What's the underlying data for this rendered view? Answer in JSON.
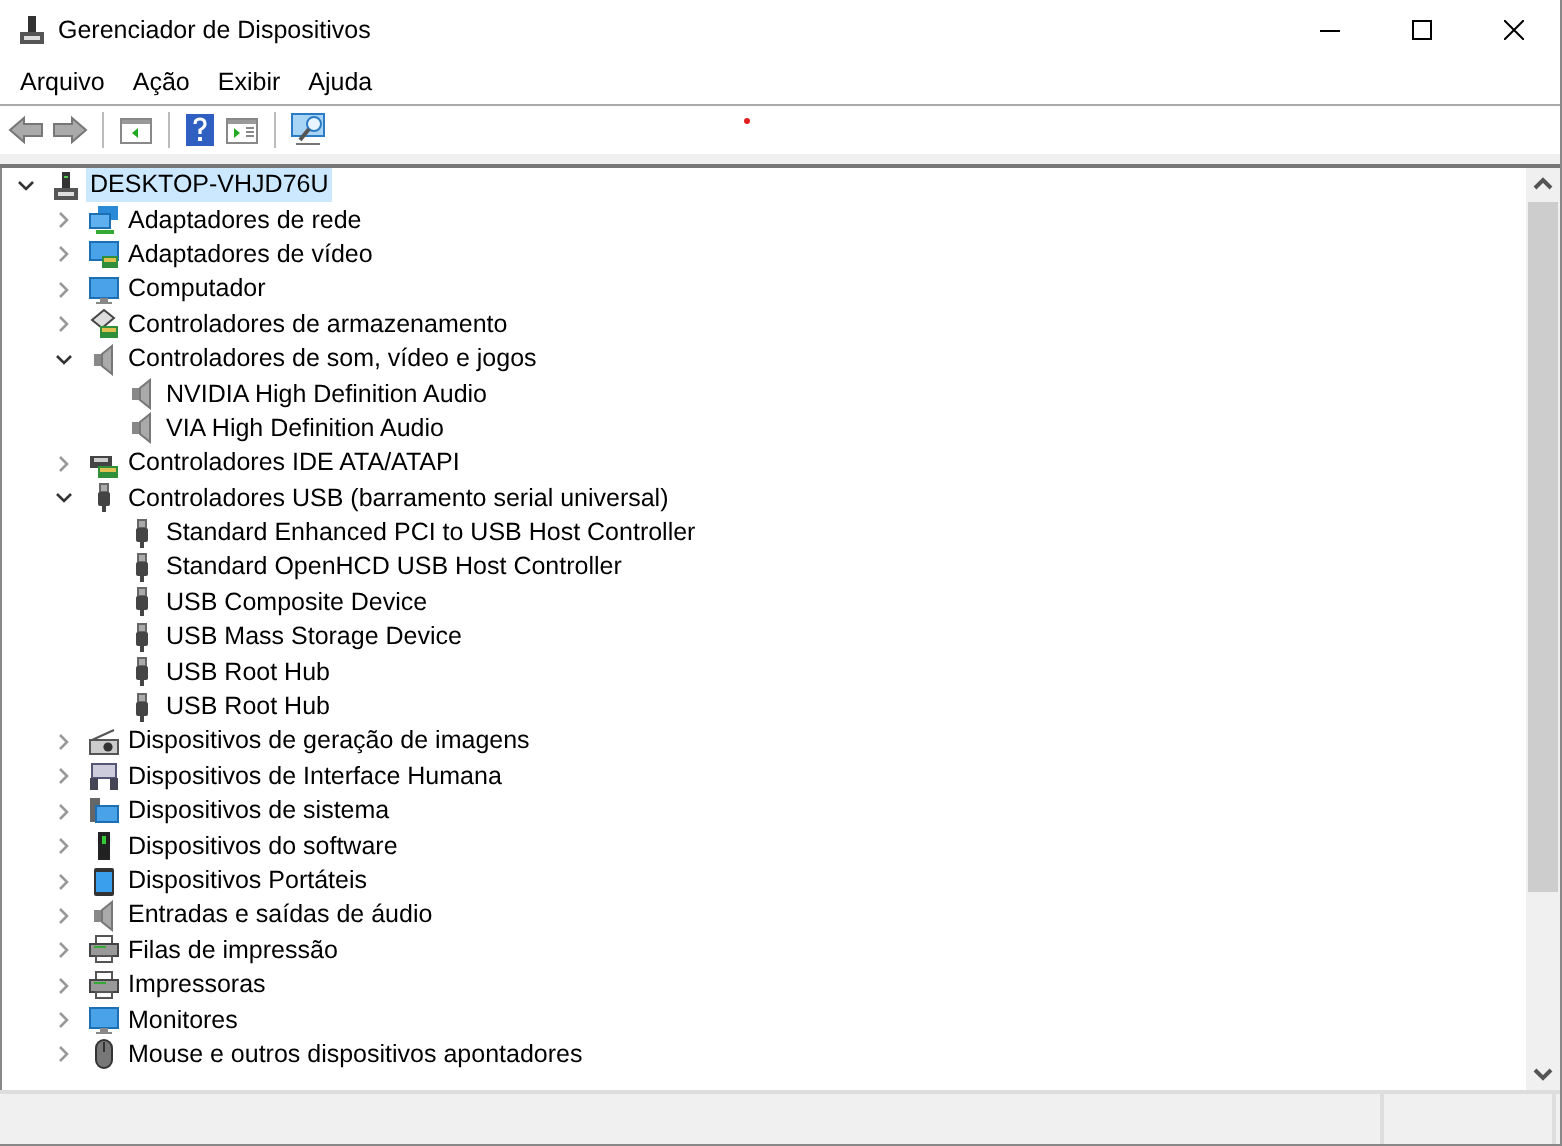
{
  "window": {
    "title": "Gerenciador de Dispositivos"
  },
  "menu": [
    "Arquivo",
    "Ação",
    "Exibir",
    "Ajuda"
  ],
  "toolbar": [
    {
      "kind": "back"
    },
    {
      "kind": "forward"
    },
    {
      "kind": "sep"
    },
    {
      "kind": "tree"
    },
    {
      "kind": "sep"
    },
    {
      "kind": "help"
    },
    {
      "kind": "pane"
    },
    {
      "kind": "sep"
    },
    {
      "kind": "scan"
    }
  ],
  "tree": [
    {
      "label": "DESKTOP-VHJD76U",
      "kind": "computer",
      "expanded": true,
      "selected": true,
      "children": [
        {
          "label": "Adaptadores de rede",
          "kind": "network",
          "expanded": false,
          "selected": false
        },
        {
          "label": "Adaptadores de vídeo",
          "kind": "display",
          "expanded": false,
          "selected": false
        },
        {
          "label": "Computador",
          "kind": "monitor",
          "expanded": false,
          "selected": false
        },
        {
          "label": "Controladores de armazenamento",
          "kind": "storage",
          "expanded": false,
          "selected": false
        },
        {
          "label": "Controladores de som, vídeo e jogos",
          "kind": "speaker",
          "expanded": true,
          "selected": false,
          "children": [
            {
              "label": "NVIDIA High Definition Audio",
              "kind": "speaker",
              "selected": false
            },
            {
              "label": "VIA High Definition Audio",
              "kind": "speaker",
              "selected": false
            }
          ]
        },
        {
          "label": "Controladores IDE ATA/ATAPI",
          "kind": "ide",
          "expanded": false,
          "selected": false
        },
        {
          "label": "Controladores USB (barramento serial universal)",
          "kind": "usb",
          "expanded": true,
          "selected": false,
          "children": [
            {
              "label": "Standard Enhanced PCI to USB Host Controller",
              "kind": "usb",
              "selected": false
            },
            {
              "label": "Standard OpenHCD USB Host Controller",
              "kind": "usb",
              "selected": false
            },
            {
              "label": "USB Composite Device",
              "kind": "usb",
              "selected": false
            },
            {
              "label": "USB Mass Storage Device",
              "kind": "usb",
              "selected": false
            },
            {
              "label": "USB Root Hub",
              "kind": "usb",
              "selected": false
            },
            {
              "label": "USB Root Hub",
              "kind": "usb",
              "selected": false
            }
          ]
        },
        {
          "label": "Dispositivos de geração de imagens",
          "kind": "camera",
          "expanded": false,
          "selected": false
        },
        {
          "label": "Dispositivos de Interface Humana",
          "kind": "keyboard",
          "expanded": false,
          "selected": false
        },
        {
          "label": "Dispositivos de sistema",
          "kind": "system",
          "expanded": false,
          "selected": false
        },
        {
          "label": "Dispositivos do software",
          "kind": "software",
          "expanded": false,
          "selected": false
        },
        {
          "label": "Dispositivos Portáteis",
          "kind": "portable",
          "expanded": false,
          "selected": false
        },
        {
          "label": "Entradas e saídas de áudio",
          "kind": "speaker",
          "expanded": false,
          "selected": false
        },
        {
          "label": "Filas de impressão",
          "kind": "printer",
          "expanded": false,
          "selected": false
        },
        {
          "label": "Impressoras",
          "kind": "printer",
          "expanded": false,
          "selected": false
        },
        {
          "label": "Monitores",
          "kind": "monitor",
          "expanded": false,
          "selected": false
        },
        {
          "label": "Mouse e outros dispositivos apontadores",
          "kind": "mouse",
          "expanded": false,
          "selected": false
        }
      ]
    }
  ]
}
